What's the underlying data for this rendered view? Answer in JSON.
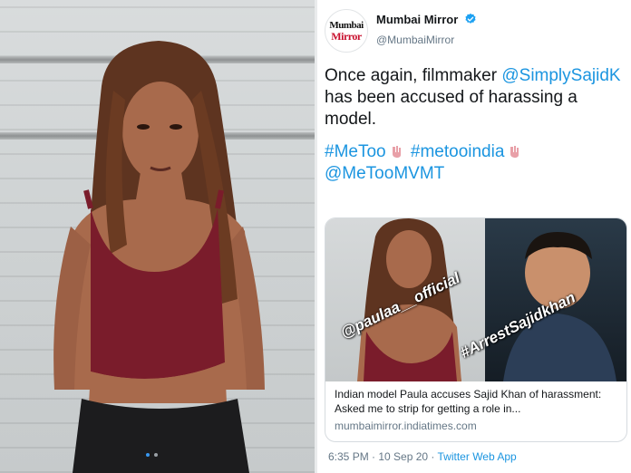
{
  "photo": {
    "carousel_dots": [
      {
        "active": true
      },
      {
        "active": false
      }
    ]
  },
  "tweet": {
    "avatar": {
      "line1": "Mumbai",
      "line2": "Mirror"
    },
    "display_name": "Mumbai Mirror",
    "handle": "@MumbaiMirror",
    "text": {
      "part1": "Once again, filmmaker ",
      "mention1": "@SimplySajidK",
      "part2": " has been accused of harassing a model.",
      "hashtag1": "#MeToo",
      "hashtag2": "#metooindia",
      "mention2": "@MeTooMVMT"
    },
    "card": {
      "overlay_1": "@paulaa__official",
      "overlay_2": "#ArrestSajidkhan",
      "title": "Indian model Paula accuses Sajid Khan of harassment: Asked me to strip for getting a role in...",
      "domain": "mumbaimirror.indiatimes.com"
    },
    "meta": {
      "time": "6:35 PM · 10 Sep 20 · ",
      "source": "Twitter Web App"
    }
  },
  "colors": {
    "link": "#1b95e0",
    "verified": "#1da1f2",
    "top": "#7a1c2b",
    "hair": "#6b3b22"
  }
}
